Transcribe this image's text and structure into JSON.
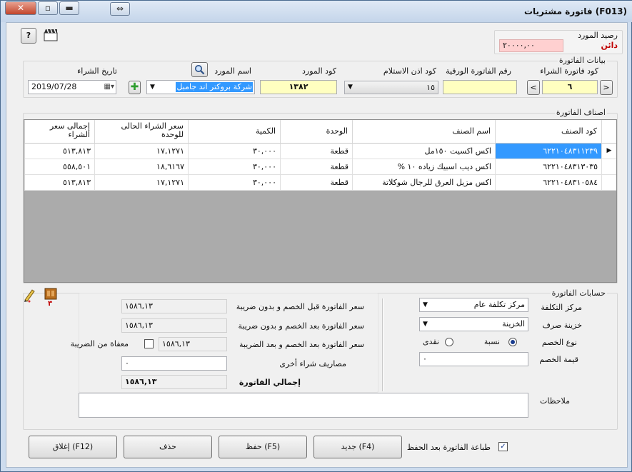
{
  "window": {
    "title": "(F013)  فاتورة مشتريات"
  },
  "supplier_balance": {
    "label": "رصيد المورد",
    "value": "٢٠٠٠٠,٠٠",
    "status": "دائن"
  },
  "invoice_data": {
    "group_label": "بيانات الفاتورة",
    "purchase_invoice_code_label": "كود فاتورة الشراء",
    "purchase_invoice_code": "٦",
    "paper_invoice_number_label": "رقم الفاتورة الورقية",
    "paper_invoice_number": "",
    "receipt_permit_code_label": "كود اذن الاستلام",
    "receipt_permit_code": "١٥",
    "supplier_code_label": "كود المورد",
    "supplier_code": "١٣٨٢",
    "supplier_name_label": "اسم المورد",
    "supplier_name": "شركة بروكتر اند جامبل",
    "purchase_date_label": "تاريخ الشراء",
    "purchase_date": "2019/07/28",
    "prev_label": "<",
    "next_label": ">"
  },
  "items": {
    "group_label": "اصناف الفاتورة",
    "columns": [
      "كود الصنف",
      "اسم الصنف",
      "الوحدة",
      "الكمية",
      "سعر الشراء الحالى للوحدة",
      "إجمالى سعر الشراء"
    ],
    "rows": [
      [
        "٦٢٢١٠٤٨٣١١٢٣٩",
        "اكس اكسيت ١٥٠مل",
        "قطعة",
        "٣٠,٠٠٠",
        "١٧,١٢٧١",
        "٥١٣,٨١٣"
      ],
      [
        "٦٢٢١٠٤٨٣١٣٠٣٥",
        "اكس ديب اسبيك زياده ١٠ %",
        "قطعة",
        "٣٠,٠٠٠",
        "١٨,٦١٦٧",
        "٥٥٨,٥٠١"
      ],
      [
        "٦٢٢١٠٤٨٣١٠٥٨٤",
        "اكس مزيل العرق للرجال شوكلاتة",
        "قطعة",
        "٣٠,٠٠٠",
        "١٧,١٢٧١",
        "٥١٣,٨١٣"
      ]
    ]
  },
  "accounts": {
    "group_label": "حسابات الفاتورة",
    "cost_center_label": "مركز التكلفة",
    "cost_center": "مركز تكلفة عام",
    "treasury_label": "خزينة صرف",
    "treasury": "الخزينة",
    "discount_type_label": "نوع الخصم",
    "discount_percent_label": "نسبة",
    "discount_cash_label": "نقدى",
    "discount_value_label": "قيمة الخصم",
    "discount_value": "٠",
    "before_discount_label": "سعر الفاتورة قبل الخصم و بدون ضريبة",
    "before_discount": "١٥٨٦,١٣",
    "after_discount_label": "سعر الفاتورة بعد الخصم و بدون ضريبة",
    "after_discount": "١٥٨٦,١٣",
    "after_discount_tax_label": "سعر الفاتورة بعد الخصم و بعد الضريبة",
    "after_discount_tax": "١٥٨٦,١٣",
    "tax_exempt_label": "معفاة من الضريبة",
    "other_expenses_label": "مصاريف شراء أخرى",
    "other_expenses": "٠",
    "total_label": "إجمالي الفاتورة",
    "total": "١٥٨٦,١٣",
    "attachments_count": "٣",
    "notes_label": "ملاحظات",
    "notes": ""
  },
  "footer": {
    "print_after_save_label": "طباعة الفاتورة بعد الحفظ",
    "new_label": "جديد (F4)",
    "save_label": "حفظ (F5)",
    "delete_label": "حذف",
    "close_label": "إغلاق (F12)"
  },
  "colors": {
    "accent_selection": "#3399ff",
    "balance_red": "#c00000",
    "yellow_field": "#ffffc0",
    "pink_field": "#ffd0d0"
  }
}
